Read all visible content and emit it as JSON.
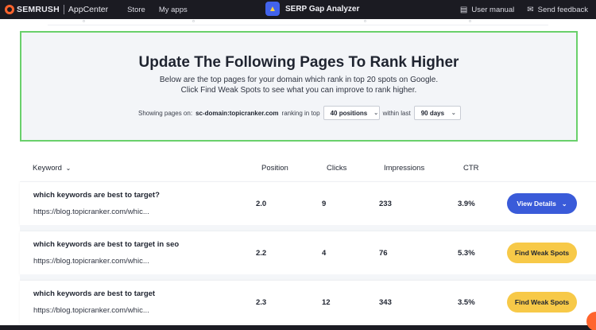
{
  "topbar": {
    "brand": "SEMRUSH",
    "appcenter": "AppCenter",
    "nav": [
      "Store",
      "My apps"
    ],
    "app_icon": "rocket-icon",
    "app_name": "SERP Gap Analyzer",
    "user_manual": "User manual",
    "send_feedback": "Send feedback"
  },
  "info": {
    "title": "Update The Following Pages To Rank Higher",
    "line1": "Below are the top pages for your domain which rank in top 20 spots on Google.",
    "line2": "Click Find Weak Spots to see what you can improve to rank higher.",
    "showing_label": "Showing pages on:",
    "domain": "sc-domain:topicranker.com",
    "ranking_label": "ranking in top",
    "positions_value": "40 positions",
    "within_label": "within last",
    "days_value": "90 days"
  },
  "table": {
    "headers": {
      "keyword": "Keyword",
      "position": "Position",
      "clicks": "Clicks",
      "impressions": "Impressions",
      "ctr": "CTR"
    },
    "rows": [
      {
        "keyword": "which keywords are best to target?",
        "url": "https://blog.topicranker.com/whic...",
        "position": "2.0",
        "clicks": "9",
        "impressions": "233",
        "ctr": "3.9%",
        "action": "View Details"
      },
      {
        "keyword": "which keywords are best to target in seo",
        "url": "https://blog.topicranker.com/whic...",
        "position": "2.2",
        "clicks": "4",
        "impressions": "76",
        "ctr": "5.3%",
        "action": "Find Weak Spots"
      },
      {
        "keyword": "which keywords are best to target",
        "url": "https://blog.topicranker.com/whic...",
        "position": "2.3",
        "clicks": "12",
        "impressions": "343",
        "ctr": "3.5%",
        "action": "Find Weak Spots"
      }
    ]
  },
  "colors": {
    "topbar_bg": "#1b1b22",
    "brand_orange": "#ff642d",
    "box_border": "#69d06b",
    "primary_blue": "#3a5bd9",
    "accent_yellow": "#f7c948"
  }
}
